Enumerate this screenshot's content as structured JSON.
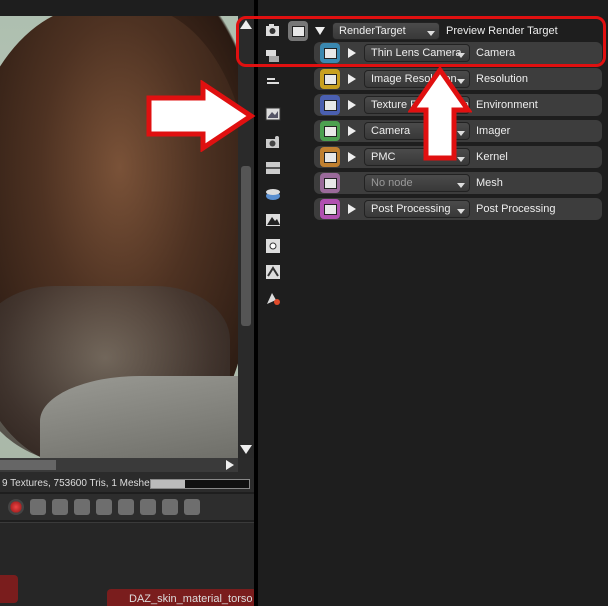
{
  "viewport": {
    "stats": "9 Textures, 753600 Tris, 1 Meshes,...",
    "progress": 0.35
  },
  "bottom": {
    "material_tab": "DAZ_skin_material_torso"
  },
  "iconstrip": [
    "camera-settings-icon",
    "render-layers-icon",
    "list-icon",
    "preview-icon",
    "camera-icon",
    "imager-icon",
    "environment-icon",
    "mountain-icon",
    "light-icon",
    "kernel-icon",
    "material-icon"
  ],
  "tree": {
    "root": {
      "dropdown": "RenderTarget",
      "label": "Preview Render Target"
    },
    "rows": [
      {
        "dropdown": "Thin Lens Camera",
        "label": "Camera",
        "color": "#3a88b0",
        "dim": false
      },
      {
        "dropdown": "Image Resolution",
        "label": "Resolution",
        "color": "#c8a020",
        "dim": false
      },
      {
        "dropdown": "Texture Environment",
        "label": "Environment",
        "color": "#4a5fb0",
        "dim": false
      },
      {
        "dropdown": "Camera",
        "label": "Imager",
        "color": "#4ca050",
        "dim": false
      },
      {
        "dropdown": "PMC",
        "label": "Kernel",
        "color": "#c08030",
        "dim": false
      },
      {
        "dropdown": "No node",
        "label": "Mesh",
        "color": "#9a6a9a",
        "dim": true
      },
      {
        "dropdown": "Post Processing",
        "label": "Post Processing",
        "color": "#b050b0",
        "dim": false
      }
    ]
  },
  "colors": {
    "annotation": "#e01010",
    "panel": "#2a2a2a"
  }
}
